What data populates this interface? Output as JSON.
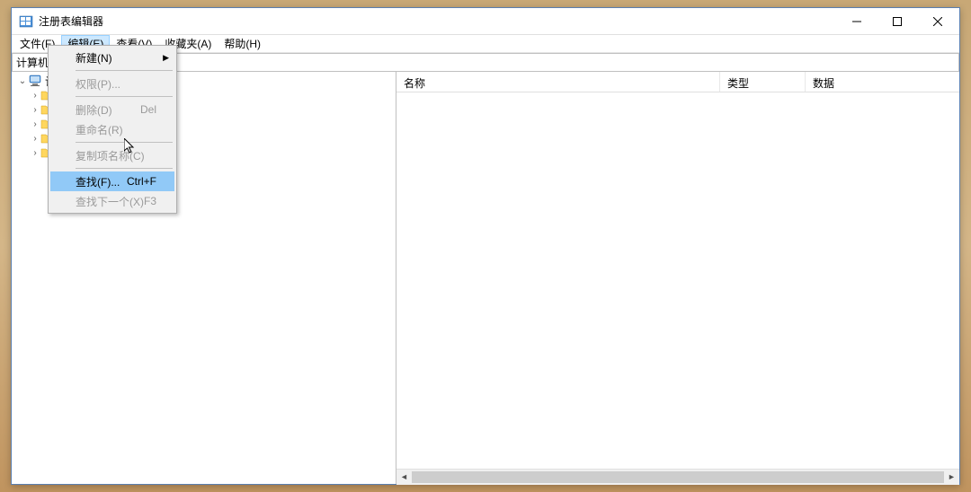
{
  "window": {
    "title": "注册表编辑器"
  },
  "menubar": {
    "file": "文件(F)",
    "edit": "编辑(E)",
    "view": "查看(V)",
    "favorites": "收藏夹(A)",
    "help": "帮助(H)"
  },
  "addressbar": {
    "path": "计算机"
  },
  "tree": {
    "root": "计",
    "children": [
      "",
      " ",
      " ",
      " ",
      " "
    ]
  },
  "columns": {
    "name": "名称",
    "type": "类型",
    "data": "数据"
  },
  "edit_menu": {
    "new": "新建(N)",
    "permissions": "权限(P)...",
    "delete": "删除(D)",
    "delete_accel": "Del",
    "rename": "重命名(R)",
    "copy_key_name": "复制项名称(C)",
    "find": "查找(F)...",
    "find_accel": "Ctrl+F",
    "find_next": "查找下一个(X)",
    "find_next_accel": "F3"
  }
}
